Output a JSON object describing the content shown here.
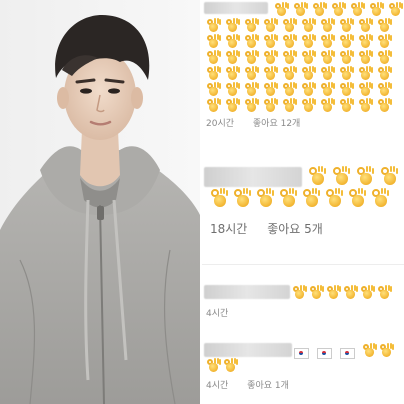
{
  "comments": [
    {
      "time": "20시간",
      "likes": "좋아요 12개",
      "emoji": "ok-hand-icon"
    },
    {
      "time": "18시간",
      "likes": "좋아요 5개",
      "emoji": "ok-hand-icon"
    },
    {
      "time": "4시간",
      "likes": "",
      "emoji": "ok-hand-icon"
    },
    {
      "time": "4시간",
      "likes": "좋아요 1개",
      "emoji": "ok-hand-icon",
      "extra": "korea-flag-icon"
    }
  ],
  "colors": {
    "emoji": "#f2b531",
    "meta_text": "#8a8a8a",
    "hoodie": "#a9a9a7",
    "background": "#ffffff"
  }
}
